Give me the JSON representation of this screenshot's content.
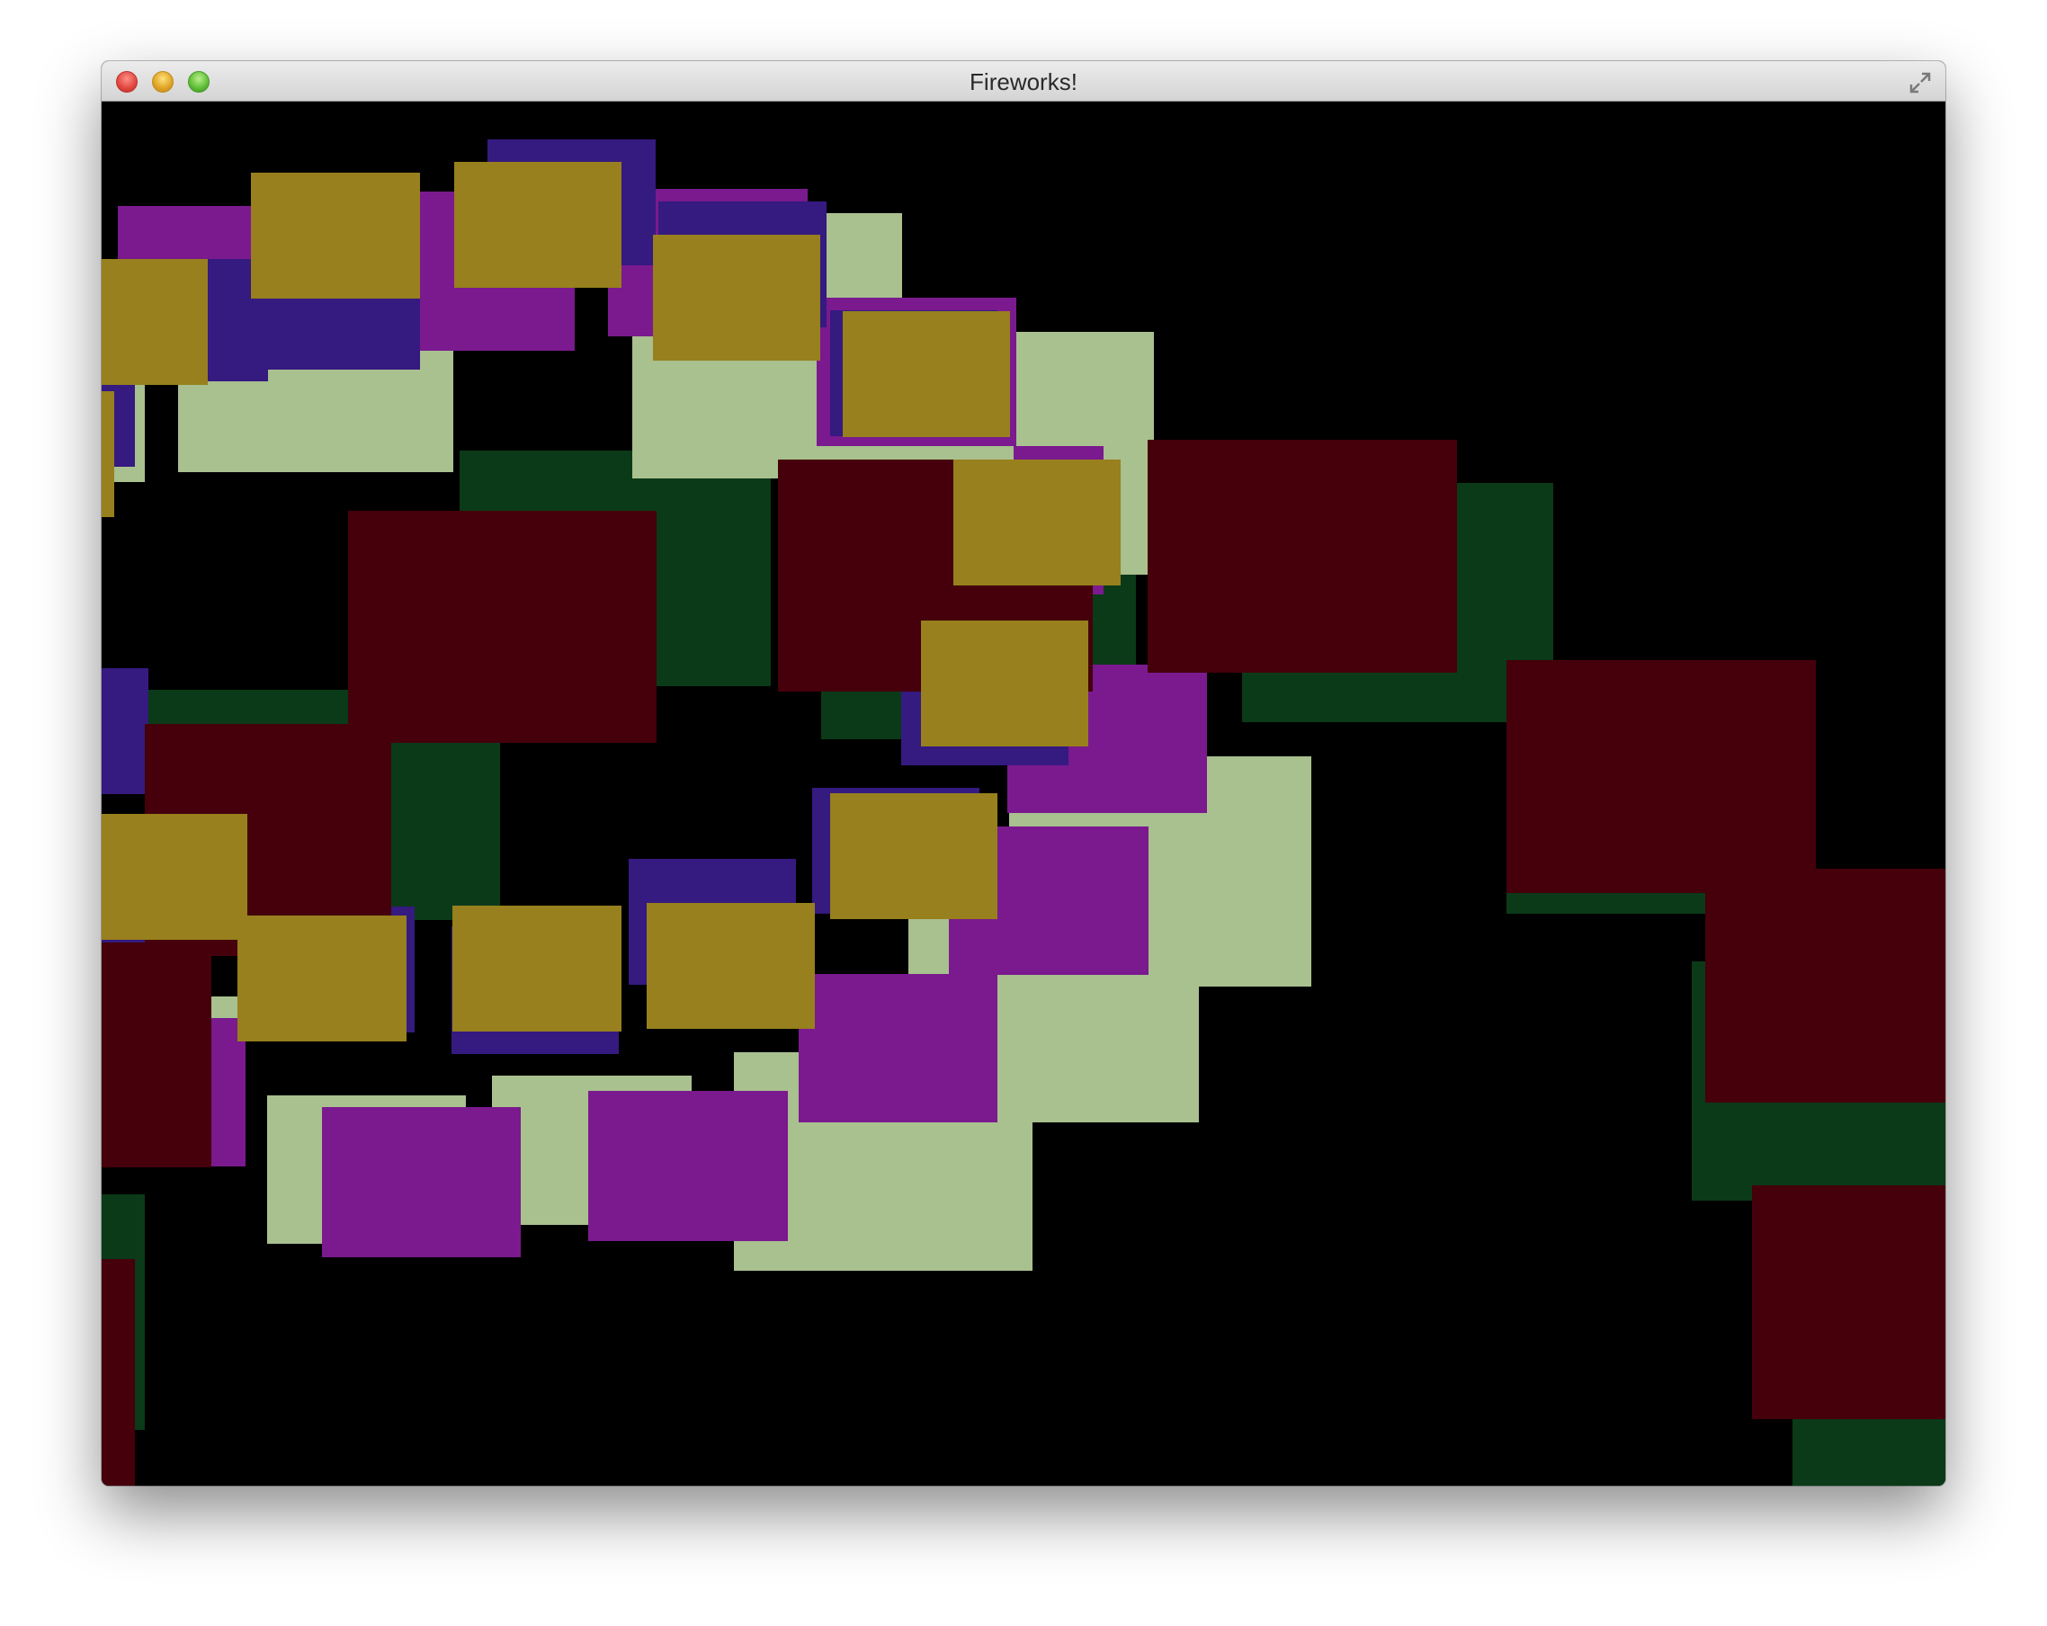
{
  "window": {
    "title": "Fireworks!"
  },
  "icons": {
    "close": "close-icon",
    "minimize": "minimize-icon",
    "zoom": "zoom-icon",
    "fullscreen": "fullscreen-arrows-icon"
  },
  "canvas": {
    "background": "#000000",
    "palette": {
      "dark_green": "#0b3a18",
      "dark_red": "#45000b",
      "purple": "#7a1a8e",
      "indigo": "#351a80",
      "pale_green": "#a9c08f",
      "olive": "#97801d"
    }
  }
}
